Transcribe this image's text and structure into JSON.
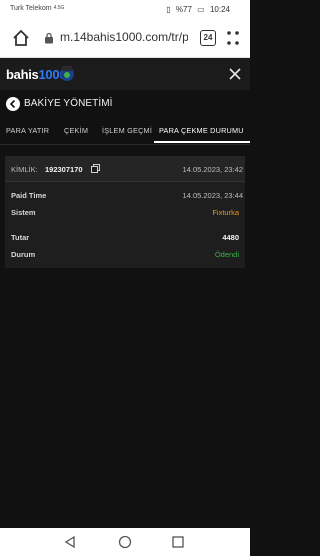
{
  "statusbar": {
    "carrier": "Turk Telekom",
    "network": "4.5G",
    "battery": "%77",
    "time": "10:24"
  },
  "browser": {
    "url": "m.14bahis1000.com/tr/p",
    "tab_count": "24"
  },
  "site": {
    "logo_text": "bahis",
    "logo_number": "1000"
  },
  "page": {
    "title": "BAKİYE YÖNETİMİ"
  },
  "tabs": [
    {
      "label": "PARA YATIR"
    },
    {
      "label": "ÇEKİM"
    },
    {
      "label": "İŞLEM GEÇMİ"
    },
    {
      "label": "PARA ÇEKME DURUMU",
      "active": true
    }
  ],
  "withdrawal": {
    "kimlik_label": "KİMLİK:",
    "kimlik_value": "192307170",
    "created_at": "14.05.2023, 23:42",
    "paid_time_label": "Paid Time",
    "paid_time_value": "14.05.2023, 23:44",
    "system_label": "Sistem",
    "system_value": "Fixturka",
    "amount_label": "Tutar",
    "amount_value": "4480",
    "status_label": "Durum",
    "status_value": "Ödendi"
  },
  "colors": {
    "accent_orange": "#e89a1c",
    "success_green": "#37b34a",
    "logo_blue": "#2f7cf6"
  }
}
